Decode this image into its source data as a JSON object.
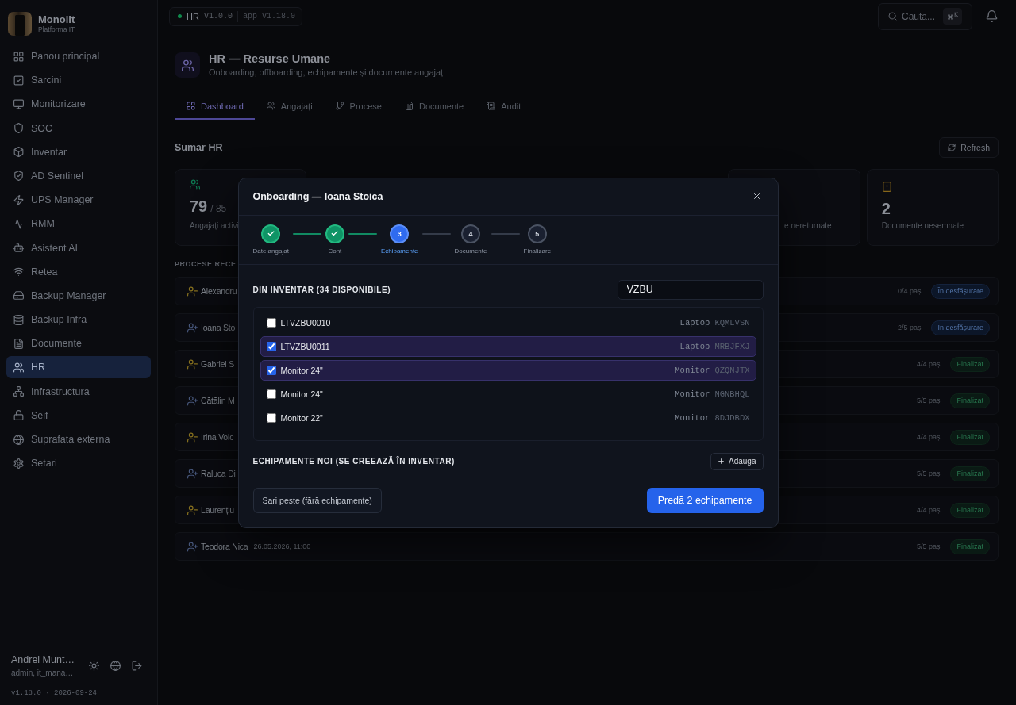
{
  "sidebar": {
    "brand": {
      "name": "Monolit",
      "subtitle": "Platforma IT"
    },
    "items": [
      {
        "label": "Panou principal",
        "selected": false
      },
      {
        "label": "Sarcini",
        "selected": false
      },
      {
        "label": "Monitorizare",
        "selected": false
      },
      {
        "label": "SOC",
        "selected": false
      },
      {
        "label": "Inventar",
        "selected": false
      },
      {
        "label": "AD Sentinel",
        "selected": false
      },
      {
        "label": "UPS Manager",
        "selected": false
      },
      {
        "label": "RMM",
        "selected": false
      },
      {
        "label": "Asistent AI",
        "selected": false
      },
      {
        "label": "Retea",
        "selected": false
      },
      {
        "label": "Backup Manager",
        "selected": false
      },
      {
        "label": "Backup Infra",
        "selected": false
      },
      {
        "label": "Documente",
        "selected": false
      },
      {
        "label": "HR",
        "selected": true
      },
      {
        "label": "Infrastructura",
        "selected": false
      },
      {
        "label": "Seif",
        "selected": false
      },
      {
        "label": "Suprafata externa",
        "selected": false
      },
      {
        "label": "Setari",
        "selected": false
      }
    ],
    "user": {
      "name": "Andrei Munt…",
      "roles": "admin, it_mana…"
    },
    "version": "v1.18.0 · 2026-09-24"
  },
  "topbar": {
    "module_badge": {
      "online": true,
      "name": "HR",
      "version": "v1.0.0",
      "app_version": "app v1.18.0"
    },
    "search": {
      "label": "Caută...",
      "shortcut": "⌘$^{K}$"
    }
  },
  "page": {
    "title": "HR — Resurse Umane",
    "subtitle": "Onboarding, offboarding, echipamente și documente angajați"
  },
  "tabs": [
    {
      "label": "Dashboard",
      "selected": true
    },
    {
      "label": "Angajați",
      "selected": false
    },
    {
      "label": "Procese",
      "selected": false
    },
    {
      "label": "Documente",
      "selected": false
    },
    {
      "label": "Audit",
      "selected": false
    }
  ],
  "summary": {
    "title": "Sumar HR",
    "refresh": "Refresh",
    "cards": [
      {
        "kind": "employees",
        "value": "79",
        "total": "/ 85",
        "label": "Angajați activi"
      },
      {
        "kind": "equipment",
        "label": "te nereturnate"
      },
      {
        "kind": "documents",
        "value": "2",
        "label": "Documente nesemnate"
      }
    ]
  },
  "processes": {
    "title": "PROCESE RECE",
    "rows": [
      {
        "kind": "offboarding",
        "name": "Alexandru",
        "steps": "0/4 pași",
        "status": "În desfășurare",
        "finished": false
      },
      {
        "kind": "onboarding",
        "name": "Ioana Sto",
        "steps": "2/5 pași",
        "status": "În desfășurare",
        "finished": false
      },
      {
        "kind": "offboarding",
        "name": "Gabriel S",
        "steps": "4/4 pași",
        "status": "Finalizat",
        "finished": true
      },
      {
        "kind": "onboarding",
        "name": "Cătălin M",
        "steps": "5/5 pași",
        "status": "Finalizat",
        "finished": true
      },
      {
        "kind": "offboarding",
        "name": "Irina Voic",
        "steps": "4/4 pași",
        "status": "Finalizat",
        "finished": true
      },
      {
        "kind": "onboarding",
        "name": "Raluca Di",
        "steps": "5/5 pași",
        "status": "Finalizat",
        "finished": true
      },
      {
        "kind": "offboarding",
        "name": "Laurențiu",
        "steps": "4/4 pași",
        "status": "Finalizat",
        "finished": true
      },
      {
        "kind": "onboarding",
        "name": "Teodora Nica",
        "date": "26.05.2026, 11:00",
        "steps": "5/5 pași",
        "status": "Finalizat",
        "finished": true
      }
    ]
  },
  "dialog": {
    "title": "Onboarding — Ioana Stoica",
    "steps": [
      {
        "label": "Date angajat",
        "done": true,
        "current": false
      },
      {
        "label": "Cont",
        "done": true,
        "current": false
      },
      {
        "number": "3",
        "label": "Echipamente",
        "done": false,
        "current": true
      },
      {
        "number": "4",
        "label": "Documente",
        "done": false,
        "current": false
      },
      {
        "number": "5",
        "label": "Finalizare",
        "done": false,
        "current": false
      }
    ],
    "inventory": {
      "title": "DIN INVENTAR (34 DISPONIBILE)",
      "search": "VZBU",
      "items": [
        {
          "name": "LTVZBU0010",
          "type": "Laptop",
          "code": "KQMLVSN",
          "checked": false
        },
        {
          "name": "LTVZBU0011",
          "type": "Laptop",
          "code": "MRBJFXJ",
          "checked": true
        },
        {
          "name": "Monitor 24\"",
          "type": "Monitor",
          "code": "QZQNJTX",
          "checked": true
        },
        {
          "name": "Monitor 24\"",
          "type": "Monitor",
          "code": "NGNBHQL",
          "checked": false
        },
        {
          "name": "Monitor 22\"",
          "type": "Monitor",
          "code": "8DJDBDX",
          "checked": false
        }
      ]
    },
    "new_equipment": {
      "title": "ECHIPAMENTE NOI (SE CREEAZĂ ÎN INVENTAR)",
      "add": "Adaugă"
    },
    "skip": "Sari peste (fără echipamente)",
    "submit": "Predă 2 echipamente"
  }
}
